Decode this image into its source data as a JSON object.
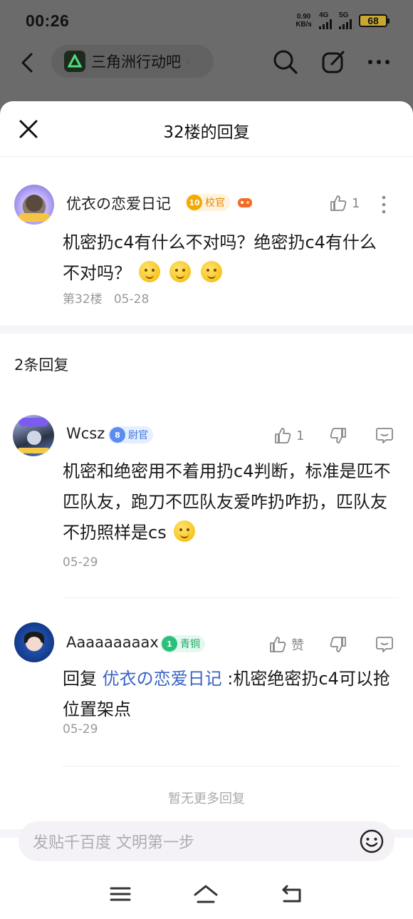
{
  "status_bar": {
    "time": "00:26",
    "net_speed_value": "0.90",
    "net_speed_unit": "KB/s",
    "sig1": "4G",
    "sig2": "5G",
    "battery": "68"
  },
  "top_nav": {
    "forum_name": "三角洲行动吧",
    "arrow": "›"
  },
  "sheet": {
    "title": "32楼的回复"
  },
  "main_post": {
    "username": "优衣の恋爱日记",
    "level": "10",
    "rank": "校官",
    "like_count": "1",
    "text": "机密扔c4有什么不对吗？绝密扔c4有什么不对吗？",
    "floor": "第32楼",
    "date": "05-28"
  },
  "reply_count_label": "2条回复",
  "replies": [
    {
      "username": "Wcsz",
      "level": "8",
      "rank": "尉官",
      "like_count": "1",
      "text": "机密和绝密用不着用扔c4判断，标准是匹不匹队友，跑刀不匹队友爱咋扔咋扔，匹队友不扔照样是cs",
      "date": "05-29"
    },
    {
      "username": "Aaaaaaaaax",
      "level": "1",
      "rank": "青铜",
      "like_label": "赞",
      "reply_prefix": "回复",
      "reply_target": "优衣の恋爱日记",
      "text": ":机密绝密扔c4可以抢位置架点",
      "date": "05-29"
    }
  ],
  "no_more": "暂无更多回复",
  "input": {
    "placeholder": "发贴千百度 文明第一步"
  },
  "colors": {
    "accent_blue": "#3a63c7",
    "level_gold": "#f2a900",
    "level_blue": "#5b8cf0",
    "level_green": "#2bbf7a"
  }
}
